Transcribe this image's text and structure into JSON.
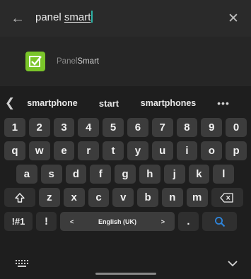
{
  "search": {
    "query_prefix": "panel ",
    "query_typed": "smart"
  },
  "result": {
    "name_light": "Panel",
    "name_bold": "Smart",
    "icon_color": "#7ac52a"
  },
  "suggestions": {
    "items": [
      "smartphone",
      "start",
      "smartphones"
    ]
  },
  "keyboard": {
    "numbers": [
      "1",
      "2",
      "3",
      "4",
      "5",
      "6",
      "7",
      "8",
      "9",
      "0"
    ],
    "row1": [
      "q",
      "w",
      "e",
      "r",
      "t",
      "y",
      "u",
      "i",
      "o",
      "p"
    ],
    "row2": [
      "a",
      "s",
      "d",
      "f",
      "g",
      "h",
      "j",
      "k",
      "l"
    ],
    "row3": [
      "z",
      "x",
      "c",
      "v",
      "b",
      "n",
      "m"
    ],
    "sym_label": "!#1",
    "exclaim": "!",
    "language": "English (UK)",
    "period": ".",
    "accent_color": "#2db3a6"
  }
}
